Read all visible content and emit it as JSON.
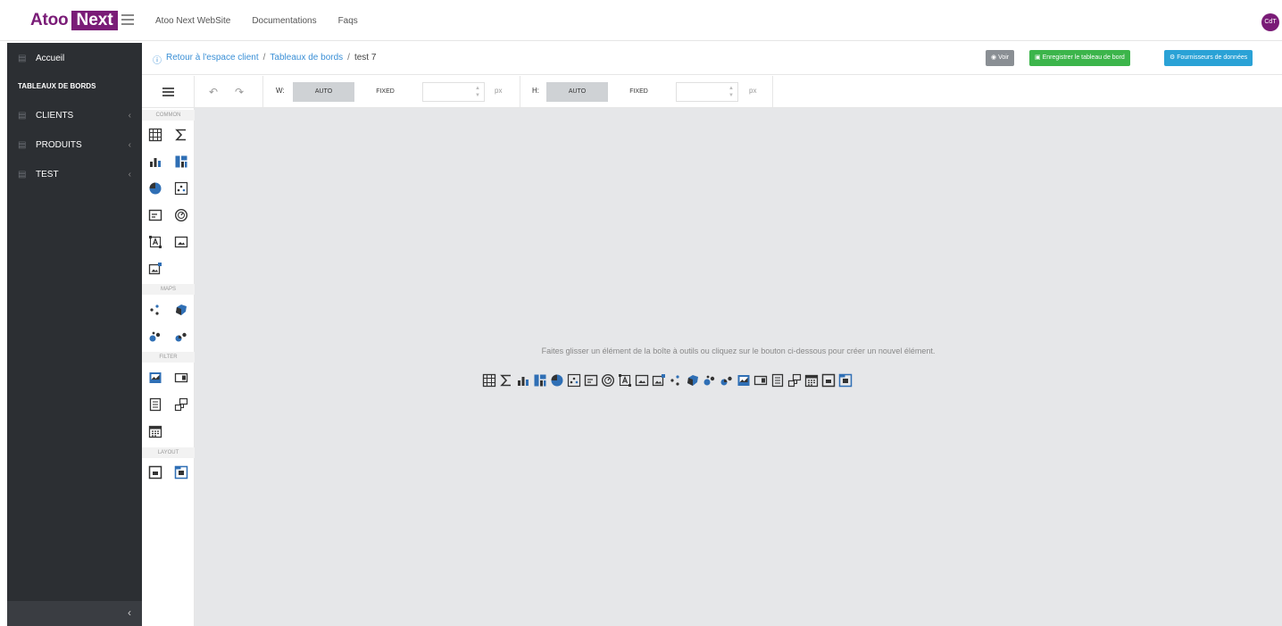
{
  "header": {
    "logo_part1": "Atoo",
    "logo_part2": "Next",
    "nav": [
      "Atoo Next WebSite",
      "Documentations",
      "Faqs"
    ],
    "avatar_initials": "CdT"
  },
  "sidebar": {
    "home_label": "Accueil",
    "section_heading": "TABLEAUX DE BORDS",
    "items": [
      {
        "label": "CLIENTS"
      },
      {
        "label": "PRODUITS"
      },
      {
        "label": "TEST"
      }
    ]
  },
  "breadcrumb": {
    "back": "Retour à l'espace client",
    "dashboards": "Tableaux de bords",
    "current": "test 7",
    "separator": "/"
  },
  "actions": {
    "view": "Voir",
    "save": "Enregistrer le tableau de bord",
    "providers": "Fournisseurs de données"
  },
  "toolbar": {
    "w_label": "W:",
    "h_label": "H:",
    "auto": "AUTO",
    "fixed": "FIXED",
    "unit": "px",
    "w_mode": "AUTO",
    "h_mode": "AUTO"
  },
  "palette": {
    "sections": [
      "COMMON",
      "MAPS",
      "FILTER",
      "LAYOUT"
    ],
    "common": [
      "grid-icon",
      "sum-icon",
      "bar-chart-icon",
      "treemap-icon",
      "pie-chart-icon",
      "scatter-icon",
      "card-icon",
      "gauge-icon",
      "text-box-icon",
      "image-icon",
      "bound-image-icon"
    ],
    "maps": [
      "geo-points-icon",
      "choropleth-icon",
      "bubble-map-icon",
      "pie-map-icon"
    ],
    "filter": [
      "range-filter-icon",
      "combo-box-icon",
      "list-box-icon",
      "tree-view-icon",
      "date-filter-icon"
    ],
    "layout": [
      "group-icon",
      "tab-container-icon"
    ]
  },
  "canvas": {
    "hint": "Faites glisser un élément de la boîte à outils ou cliquez sur le bouton ci-dessous pour créer un nouvel élément."
  },
  "colors": {
    "brand": "#7a1c77",
    "sidebar_bg": "#2c2f33",
    "canvas_bg": "#e6e7e9",
    "link": "#3a8fd6",
    "save_green": "#3cb54b",
    "provider_blue": "#2aa2d6",
    "icon_blue": "#2f6fb5"
  }
}
